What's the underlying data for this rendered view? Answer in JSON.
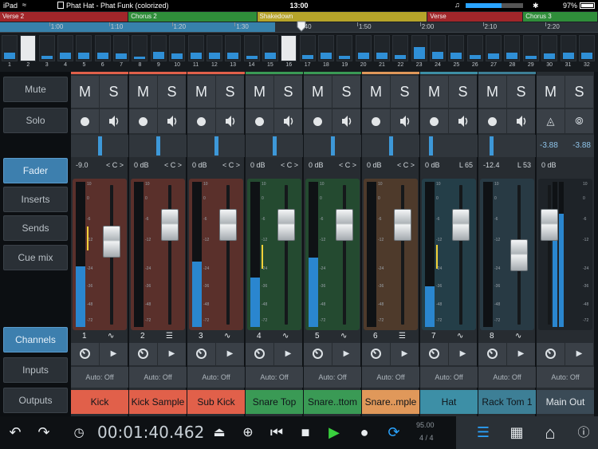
{
  "status": {
    "device": "iPad",
    "document": "Phat Hat - Phat Funk (colorized)",
    "time": "13:00",
    "volume_fraction": 0.62,
    "battery": "97%",
    "battery_fraction": 0.97
  },
  "arranger": {
    "sections": [
      {
        "label": "Verse 2",
        "color": "#a1262a",
        "start": 0.0,
        "end": 0.215
      },
      {
        "label": "Chorus 2",
        "color": "#2f8e3a",
        "start": 0.215,
        "end": 0.43
      },
      {
        "label": "Shakedown",
        "color": "#b6a42a",
        "start": 0.43,
        "end": 0.715
      },
      {
        "label": "Verse",
        "color": "#a1262a",
        "start": 0.715,
        "end": 0.875
      },
      {
        "label": "Chorus 3",
        "color": "#2f8e3a",
        "start": 0.875,
        "end": 1.0
      }
    ],
    "loop": {
      "start": 0.0,
      "end": 0.46
    },
    "ruler": [
      "1:00",
      "1:10",
      "1:20",
      "1:30",
      "1:40",
      "1:50",
      "2:00",
      "2:10",
      "2:20"
    ],
    "ruler_pos": [
      0.085,
      0.185,
      0.29,
      0.395,
      0.5,
      0.6,
      0.705,
      0.81,
      0.915
    ],
    "overview": [
      {
        "n": "1",
        "level": 0.3,
        "sel": false
      },
      {
        "n": "2",
        "level": 0.0,
        "sel": true
      },
      {
        "n": "3",
        "level": 0.15,
        "sel": false
      },
      {
        "n": "4",
        "level": 0.3,
        "sel": false
      },
      {
        "n": "5",
        "level": 0.3,
        "sel": false
      },
      {
        "n": "6",
        "level": 0.3,
        "sel": false
      },
      {
        "n": "7",
        "level": 0.25,
        "sel": false
      },
      {
        "n": "8",
        "level": 0.1,
        "sel": false
      },
      {
        "n": "9",
        "level": 0.35,
        "sel": false
      },
      {
        "n": "10",
        "level": 0.25,
        "sel": false
      },
      {
        "n": "11",
        "level": 0.3,
        "sel": false
      },
      {
        "n": "12",
        "level": 0.3,
        "sel": false
      },
      {
        "n": "13",
        "level": 0.3,
        "sel": false
      },
      {
        "n": "14",
        "level": 0.15,
        "sel": false
      },
      {
        "n": "15",
        "level": 0.3,
        "sel": false
      },
      {
        "n": "16",
        "level": 0.0,
        "sel": true
      },
      {
        "n": "17",
        "level": 0.2,
        "sel": false
      },
      {
        "n": "18",
        "level": 0.3,
        "sel": false
      },
      {
        "n": "19",
        "level": 0.15,
        "sel": false
      },
      {
        "n": "20",
        "level": 0.3,
        "sel": false
      },
      {
        "n": "21",
        "level": 0.3,
        "sel": false
      },
      {
        "n": "22",
        "level": 0.2,
        "sel": false
      },
      {
        "n": "23",
        "level": 0.55,
        "sel": false
      },
      {
        "n": "24",
        "level": 0.35,
        "sel": false
      },
      {
        "n": "25",
        "level": 0.3,
        "sel": false
      },
      {
        "n": "26",
        "level": 0.2,
        "sel": false
      },
      {
        "n": "27",
        "level": 0.25,
        "sel": false
      },
      {
        "n": "28",
        "level": 0.3,
        "sel": false
      },
      {
        "n": "29",
        "level": 0.15,
        "sel": false
      },
      {
        "n": "30",
        "level": 0.25,
        "sel": false
      },
      {
        "n": "31",
        "level": 0.3,
        "sel": false
      },
      {
        "n": "32",
        "level": 0.3,
        "sel": false
      }
    ]
  },
  "leftpanel": {
    "mute": "Mute",
    "solo": "Solo",
    "fader": "Fader",
    "inserts": "Inserts",
    "sends": "Sends",
    "cue": "Cue mix",
    "channels": "Channels",
    "inputs": "Inputs",
    "outputs": "Outputs"
  },
  "strip_labels": {
    "mute": "M",
    "solo": "S",
    "auto": "Auto: Off"
  },
  "channels": [
    {
      "num": "1",
      "name": "Kick",
      "level": "-9.0",
      "pan": "< C >",
      "color": "#e1604a",
      "tint": "#5a302b",
      "fader": 0.62,
      "meter": 0.42,
      "yellow": 0.68,
      "panpos": 0.5,
      "icon": "wave"
    },
    {
      "num": "2",
      "name": "Kick Sample",
      "level": "0 dB",
      "pan": "< C >",
      "color": "#e1604a",
      "tint": "#5a302b",
      "fader": 0.78,
      "meter": 0.0,
      "yellow": 0.0,
      "panpos": 0.5,
      "icon": "piano"
    },
    {
      "num": "3",
      "name": "Sub Kick",
      "level": "0 dB",
      "pan": "< C >",
      "color": "#e1604a",
      "tint": "#5a302b",
      "fader": 0.78,
      "meter": 0.45,
      "yellow": 0.0,
      "panpos": 0.5,
      "icon": "wave"
    },
    {
      "num": "4",
      "name": "Snare Top",
      "level": "0 dB",
      "pan": "< C >",
      "color": "#3a9a55",
      "tint": "#244a30",
      "fader": 0.78,
      "meter": 0.34,
      "yellow": 0.55,
      "panpos": 0.5,
      "icon": "wave"
    },
    {
      "num": "5",
      "name": "Snare..ttom",
      "level": "0 dB",
      "pan": "< C >",
      "color": "#3a9a55",
      "tint": "#244a30",
      "fader": 0.78,
      "meter": 0.48,
      "yellow": 0.0,
      "panpos": 0.5,
      "icon": "wave"
    },
    {
      "num": "6",
      "name": "Snare..mple",
      "level": "0 dB",
      "pan": "< C >",
      "color": "#e0985a",
      "tint": "#4e3a2b",
      "fader": 0.78,
      "meter": 0.0,
      "yellow": 0.0,
      "panpos": 0.5,
      "icon": "piano"
    },
    {
      "num": "7",
      "name": "Hat",
      "level": "0 dB",
      "pan": "L 65",
      "color": "#3d8fa6",
      "tint": "#243e48",
      "fader": 0.78,
      "meter": 0.28,
      "yellow": 0.55,
      "panpos": 0.18,
      "icon": "wave"
    },
    {
      "num": "8",
      "name": "Rack Tom 1",
      "level": "-12.4",
      "pan": "L 53",
      "color": "#3d7f96",
      "tint": "#283a44",
      "fader": 0.5,
      "meter": 0.0,
      "yellow": 0.0,
      "panpos": 0.22,
      "icon": "wave"
    }
  ],
  "master": {
    "name": "Main Out",
    "level_l": "-3.88",
    "level_r": "-3.88",
    "level": "0 dB",
    "fader": 0.78,
    "meter": 0.78
  },
  "transport": {
    "timecode": "00:01:40.462",
    "tempo": "95.00",
    "signature": "4 / 4"
  }
}
